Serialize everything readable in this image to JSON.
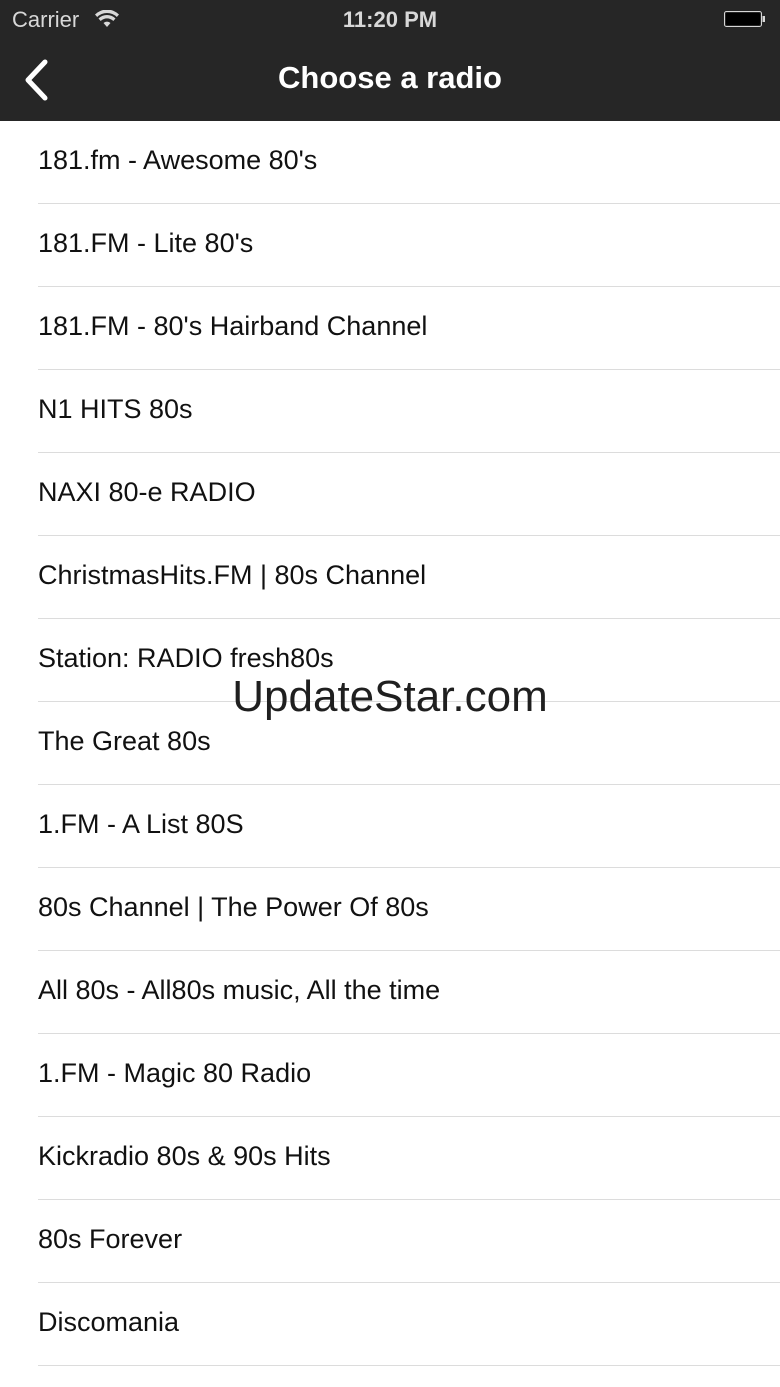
{
  "status_bar": {
    "carrier": "Carrier",
    "time": "11:20 PM"
  },
  "nav": {
    "title": "Choose a radio",
    "back_icon": "chevron-left-icon"
  },
  "stations": [
    "181.fm - Awesome 80's",
    "181.FM - Lite 80's",
    "181.FM - 80's Hairband Channel",
    "N1 HITS 80s",
    "NAXI 80-e RADIO",
    "ChristmasHits.FM | 80s Channel",
    "Station: RADIO fresh80s",
    "The Great 80s",
    "1.FM - A List 80S",
    "80s Channel | The Power Of 80s",
    "All 80s - All80s music, All the time",
    "1.FM - Magic 80 Radio",
    "Kickradio 80s & 90s Hits",
    "80s Forever",
    "Discomania"
  ],
  "watermark": "UpdateStar.com",
  "colors": {
    "header_bg": "#262626",
    "header_text": "#ffffff",
    "separator": "#dcdcdc"
  }
}
